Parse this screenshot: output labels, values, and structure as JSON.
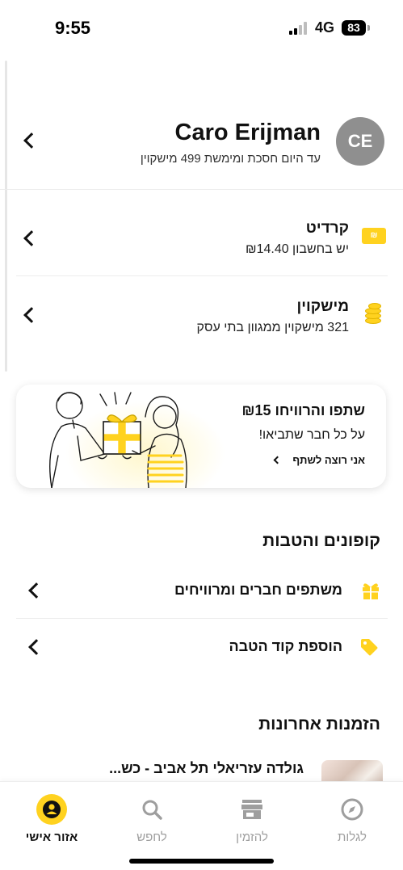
{
  "status_bar": {
    "time": "9:55",
    "network": "4G",
    "battery": "83"
  },
  "profile": {
    "initials": "CE",
    "name": "Caro Erijman",
    "subtitle": "עד היום חסכת ומימשת 499 מישקוין"
  },
  "wallet": [
    {
      "title": "קרדיט",
      "subtitle": "יש בחשבון ₪14.40",
      "icon": "credit-icon",
      "icon_text": "₪"
    },
    {
      "title": "מישקוין",
      "subtitle": "321 מישקוין ממגוון בתי עסק",
      "icon": "coins-icon"
    }
  ],
  "referral_banner": {
    "title": "שתפו והרוויחו ₪15",
    "subtitle": "על כל חבר שתביאו!",
    "cta": "אני רוצה לשתף"
  },
  "coupons": {
    "title": "קופונים והטבות",
    "items": [
      {
        "label": "משתפים חברים ומרוויחים",
        "icon": "gift-icon"
      },
      {
        "label": "הוספת קוד הטבה",
        "icon": "tag-icon"
      }
    ]
  },
  "recent_orders": {
    "title": "הזמנות אחרונות",
    "items": [
      {
        "title": "גולדה עזריאלי תל אביב - כש..."
      }
    ]
  },
  "tabbar": [
    {
      "label": "לגלות",
      "icon": "compass-icon",
      "active": false
    },
    {
      "label": "להזמין",
      "icon": "store-icon",
      "active": false
    },
    {
      "label": "לחפש",
      "icon": "search-icon",
      "active": false
    },
    {
      "label": "אזור אישי",
      "icon": "profile-icon",
      "active": true
    }
  ],
  "colors": {
    "accent": "#FFD21F",
    "text": "#111111",
    "muted": "#9E9E9E"
  }
}
